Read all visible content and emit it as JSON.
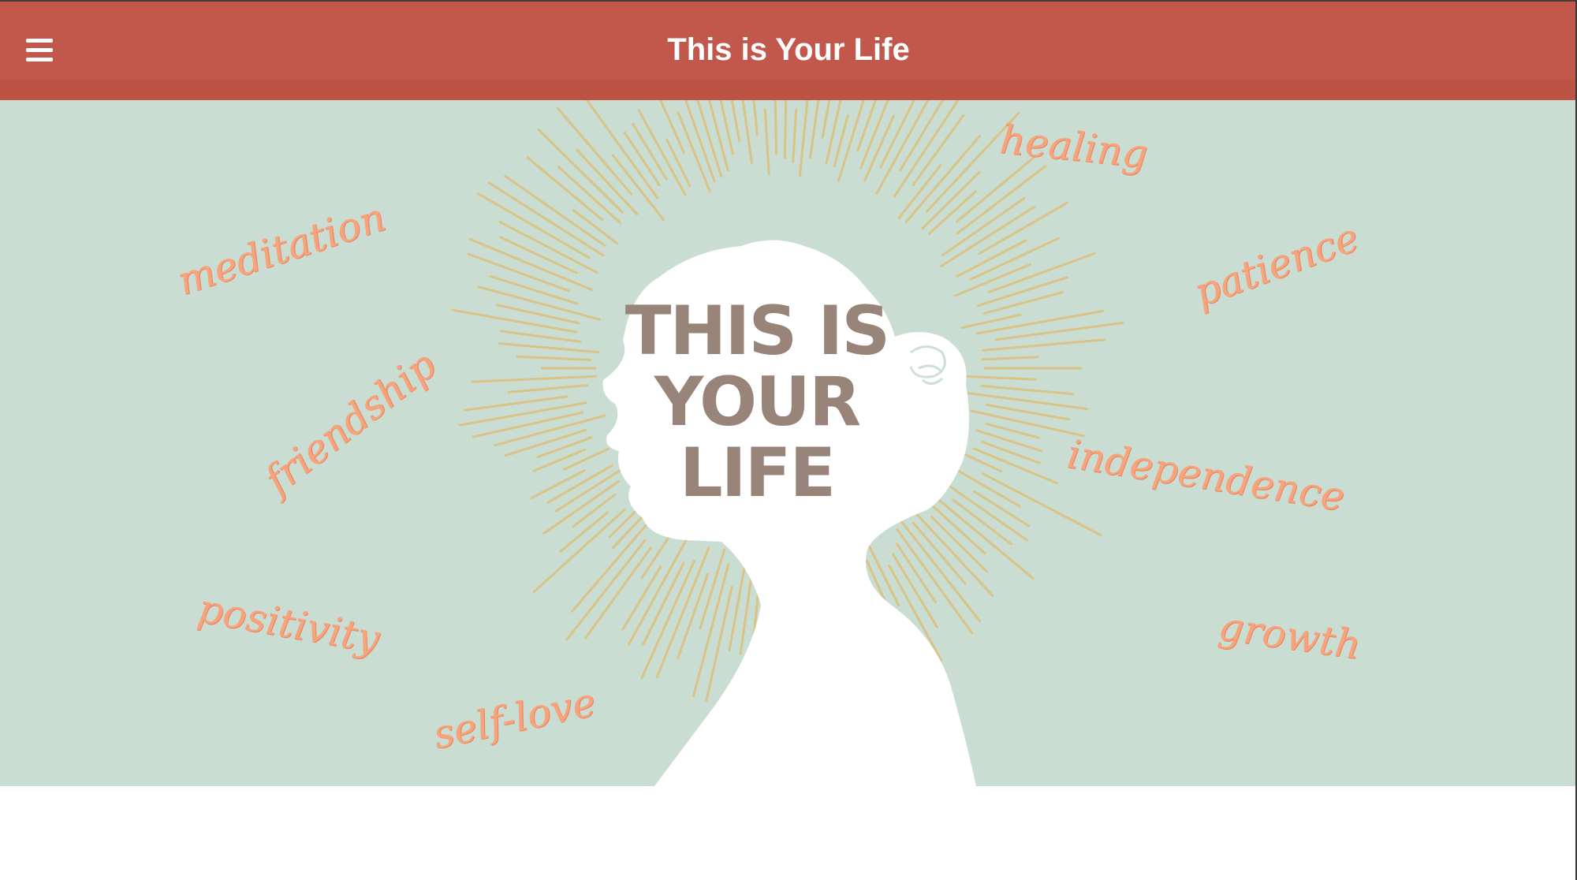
{
  "header": {
    "title": "This is Your Life",
    "menu_icon": "hamburger-menu-icon",
    "background_color": "#c2584b"
  },
  "hero": {
    "background_color": "#c9ddd2",
    "title_lines": [
      "THIS IS",
      "YOUR",
      "LIFE"
    ],
    "words": {
      "meditation": "meditation",
      "friendship": "friendship",
      "positivity": "positivity",
      "self_love": "self-love",
      "healing": "healing",
      "patience": "patience",
      "independence": "independence",
      "growth": "growth"
    },
    "word_color": "#f7a37c",
    "ray_color": "#dcbf7b",
    "silhouette_color": "#ffffff"
  }
}
